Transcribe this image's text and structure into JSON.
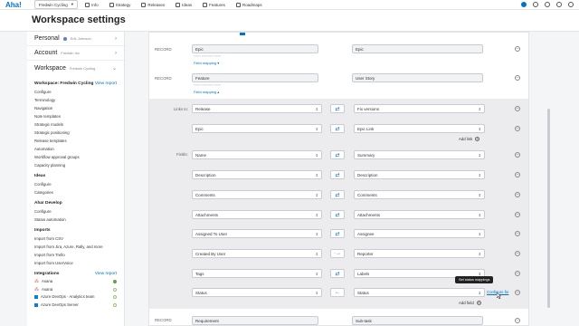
{
  "topbar": {
    "logo": "Aha!",
    "workspace": "Fredwin Cycling",
    "nav": [
      "Info",
      "Strategy",
      "Releases",
      "Ideas",
      "Features",
      "Roadmaps"
    ]
  },
  "page": {
    "title": "Workspace settings"
  },
  "sidebar": {
    "accounts": [
      {
        "label": "Personal",
        "sub": "Erik Johnson"
      },
      {
        "label": "Account",
        "sub": "Fredwin Inc"
      },
      {
        "label": "Workspace",
        "sub": "Fredwin Cycling"
      }
    ],
    "workspace_heading": "Workspace: Fredwin Cycling",
    "view_report": "View report",
    "workspace_links": [
      "Configure",
      "Terminology",
      "Navigation",
      "Note templates",
      "Strategic models",
      "Strategic positioning",
      "Release templates",
      "Automation",
      "Workflow approval groups",
      "Capacity planning"
    ],
    "ideas_heading": "Ideas",
    "ideas_links": [
      "Configure",
      "Categories"
    ],
    "develop_heading": "Aha! Develop",
    "develop_links": [
      "Configure",
      "Status automation"
    ],
    "imports_heading": "Imports",
    "imports_links": [
      "Import from CSV",
      "Import from Jira, Azure, Rally, and more",
      "Import from Trello",
      "Import from UserVoice"
    ],
    "integrations_heading": "Integrations",
    "integrations_report": "View report",
    "integrations": [
      {
        "name": "Asana",
        "icon": "asana-icon",
        "status": "on"
      },
      {
        "name": "Asana",
        "icon": "asana-icon",
        "status": "off"
      },
      {
        "name": "Azure DevOps - Analytics team",
        "icon": "azure-devops-icon",
        "status": "off"
      },
      {
        "name": "Azure DevOps Server",
        "icon": "azure-devops-icon",
        "status": "off"
      }
    ]
  },
  "main": {
    "record_label": "RECORD",
    "records": [
      {
        "left": "Epic",
        "right": "Epic",
        "field_mapping": "Field mapping"
      },
      {
        "left": "Feature",
        "right": "User Story",
        "field_mapping": "Field mapping"
      }
    ],
    "links_to_label": "Links to:",
    "links": [
      {
        "left": "Release",
        "right": "Fix versions"
      },
      {
        "left": "Epic",
        "right": "Epic Link"
      }
    ],
    "add_link": "Add link",
    "fields_label": "Fields:",
    "fields": [
      {
        "left": "Name",
        "right": "Summary",
        "dir": "both"
      },
      {
        "left": "Description",
        "right": "Description",
        "dir": "both"
      },
      {
        "left": "Comments",
        "right": "Comments",
        "dir": "both"
      },
      {
        "left": "Attachments",
        "right": "Attachments",
        "dir": "both"
      },
      {
        "left": "Assigned To User",
        "right": "Assignee",
        "dir": "both"
      },
      {
        "left": "Created By User",
        "right": "Reporter",
        "dir": "right"
      },
      {
        "left": "Tags",
        "right": "Labels",
        "dir": "both"
      },
      {
        "left": "Status",
        "right": "Status",
        "dir": "left"
      }
    ],
    "tooltip": "Set status mappings",
    "configure": "Configure fie",
    "add_field": "Add field",
    "bottom_record": {
      "left": "Requirement",
      "right": "Sub-task"
    }
  }
}
